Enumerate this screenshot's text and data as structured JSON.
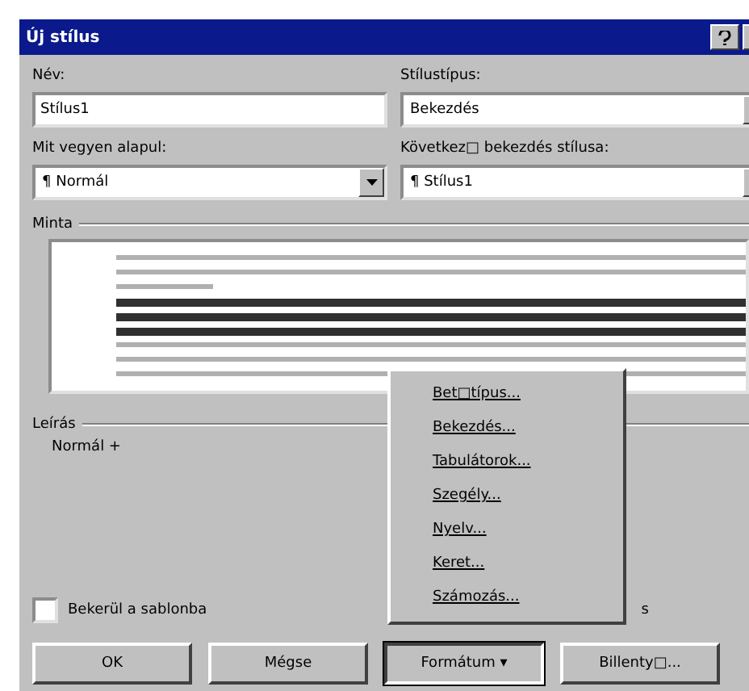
{
  "window": {
    "title": "Új stílus"
  },
  "fields": [
    {
      "label": "Név:",
      "value": "Stílus1",
      "kind": "text"
    },
    {
      "label": "Stílustípus:",
      "value": "Bekezdés",
      "kind": "combo"
    },
    {
      "label": "Mit vegyen alapul:",
      "value": "¶ Normál",
      "kind": "combo"
    },
    {
      "label": "Következ□ bekezdés stílusa:",
      "value": "¶ Stílus1",
      "kind": "combo"
    }
  ],
  "sample": {
    "label": "Minta"
  },
  "description": {
    "label": "Leírás",
    "text": "Normál +"
  },
  "add_to_template": {
    "label": "Bekerül a sablonba",
    "checked": false
  },
  "hidden_option_tail": "s",
  "menu": {
    "items": [
      {
        "label": "Bet□típus..."
      },
      {
        "label": "Bekezdés..."
      },
      {
        "label": "Tabulátorok..."
      },
      {
        "label": "Szegély..."
      },
      {
        "label": "Nyelv..."
      },
      {
        "label": "Keret..."
      },
      {
        "label": "Számozás..."
      }
    ]
  },
  "buttons": [
    {
      "label": "OK",
      "pressed": false
    },
    {
      "label": "Mégse",
      "pressed": false
    },
    {
      "label": "Formátum ▾",
      "pressed": true
    },
    {
      "label": "Billenty□...",
      "pressed": false
    }
  ]
}
